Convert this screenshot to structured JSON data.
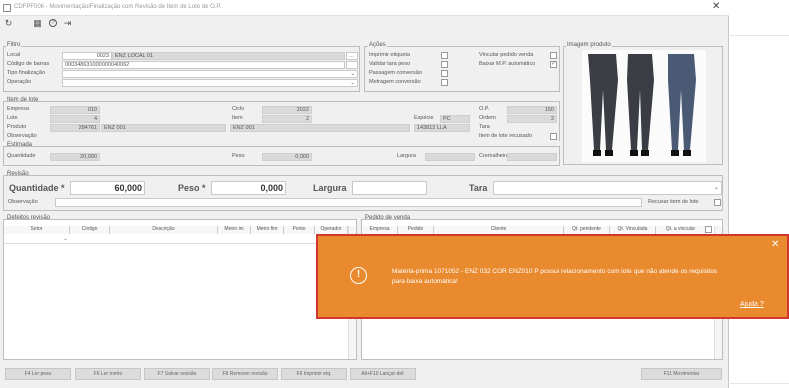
{
  "window": {
    "title": "CDFPF006 - Movimentação/Finalização com Revisão de Item de Lote de O.P.",
    "close": "✕"
  },
  "toolbar": {
    "refresh": "↻",
    "calendar": "▦",
    "help": "?",
    "exit": "⇥"
  },
  "filtro": {
    "title": "Filtro",
    "local_label": "Local",
    "local_code": "0023",
    "local_name": "ENZ LOCAL 01",
    "barcode_label": "Código de barras",
    "barcode_value": "000348631000000040062",
    "tipo_label": "Tipo finalização",
    "operacao_label": "Operação"
  },
  "acoes": {
    "title": "Ações",
    "imprimir": "Imprimir etiqueta",
    "validar": "Validar tara peso",
    "passagem": "Passagem conversão",
    "metragem": "Metragem conversão",
    "vincular": "Vincular pedido venda",
    "baixar": "Baixar M.P. automático"
  },
  "imagem": {
    "title": "Imagem produto"
  },
  "item_lote": {
    "title": "Item de lote",
    "empresa_label": "Empresa",
    "empresa": "010",
    "lote_label": "Lote",
    "lote": "4",
    "produto_label": "Produto",
    "produto_code": "284761",
    "produto_name": "ENZ 001",
    "observacao_label": "Observação",
    "ciclo_label": "Ciclo",
    "ciclo": "2022",
    "item_label": "Item",
    "item": "2",
    "ciclo2": "ENZ 001",
    "especie_label": "Espécie",
    "especie": "PC",
    "especie2": "143812 LLA",
    "op_label": "O.P.",
    "op": "150",
    "ordem_label": "Ordem",
    "ordem": "2",
    "tara_label": "Tara",
    "recusado_label": "Item de lote recusado"
  },
  "estimada": {
    "title": "Estimada",
    "quantidade_label": "Quantidade",
    "quantidade": "20,000",
    "peso_label": "Peso",
    "peso": "0,000",
    "largura_label": "Largura",
    "cremalheira_label": "Cremalheira"
  },
  "revisao": {
    "title": "Revisão",
    "quantidade_label": "Quantidade *",
    "quantidade": "60,000",
    "peso_label": "Peso *",
    "peso": "0,000",
    "largura_label": "Largura",
    "tara_label": "Tara",
    "observacao_label": "Observação",
    "recusar_label": "Recusar item de lote"
  },
  "defeitos": {
    "title": "Defeitos revisão",
    "columns": [
      "Setor",
      "Código",
      "Descrição",
      "Metro ini",
      "Metro fim",
      "Ponto",
      "Operador"
    ]
  },
  "pedido": {
    "title": "Pedido de venda",
    "columns": [
      "Empresa",
      "Pedido",
      "Cliente",
      "Qt. pendente",
      "Qt. Vinculada",
      "Qt. a vincular"
    ]
  },
  "buttons": {
    "f4": "F4 Ler peso",
    "f6": "F6 Ler metro",
    "f7": "F7 Salvar revisão",
    "f8": "F8 Remover revisão",
    "f9": "F9 Imprimir etq.",
    "altf10": "Alt+F10 Lançar def.",
    "f11": "F11 Movimentar"
  },
  "toast": {
    "icon": "!",
    "message": "Matéria-prima 1071052 - ENZ 032 COR ENZ010 P possui relacionamento com lote que não atende os requisitos para baixa automática!",
    "help": "Ajuda ?",
    "close": "✕",
    "color": "#e98a2e",
    "border": "#d3362f"
  }
}
